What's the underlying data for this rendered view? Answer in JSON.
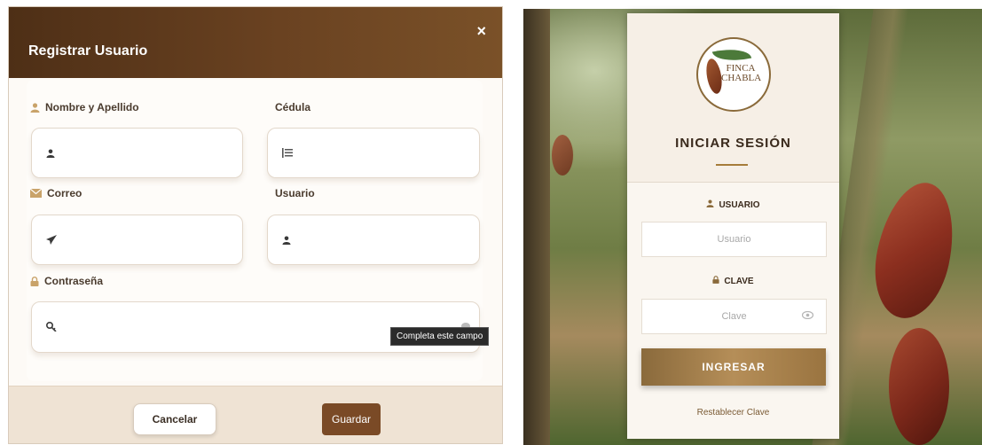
{
  "register_modal": {
    "title": "Registrar Usuario",
    "close_glyph": "×",
    "fields": {
      "full_name": {
        "label": "Nombre y Apellido",
        "icon": "user-icon",
        "value": ""
      },
      "id_number": {
        "label": "Cédula",
        "icon": "list-icon",
        "value": ""
      },
      "email": {
        "label": "Correo",
        "icon": "envelope-icon",
        "input_icon": "paper-plane-icon",
        "value": ""
      },
      "username": {
        "label": "Usuario",
        "icon": "user-icon",
        "value": ""
      },
      "password": {
        "label": "Contraseña",
        "icon": "lock-icon",
        "input_icon": "key-icon",
        "value": ""
      }
    },
    "tooltip": "Completa este campo",
    "buttons": {
      "cancel": "Cancelar",
      "save": "Guardar"
    },
    "colors": {
      "header_dark": "#4e2f16",
      "header_light": "#7a5128",
      "save_button": "#7a4a26",
      "footer": "#efe3d4",
      "label_icon": "#c9a36a"
    }
  },
  "login": {
    "logo": {
      "text": "FINCA CHABLA"
    },
    "title": "INICIAR SESIÓN",
    "username_label": "USUARIO",
    "username_placeholder": "Usuario",
    "password_label": "CLAVE",
    "password_placeholder": "Clave",
    "submit_label": "INGRESAR",
    "reset_link": "Restablecer Clave",
    "colors": {
      "accent": "#a67c3a",
      "button": "#b58e58"
    }
  }
}
